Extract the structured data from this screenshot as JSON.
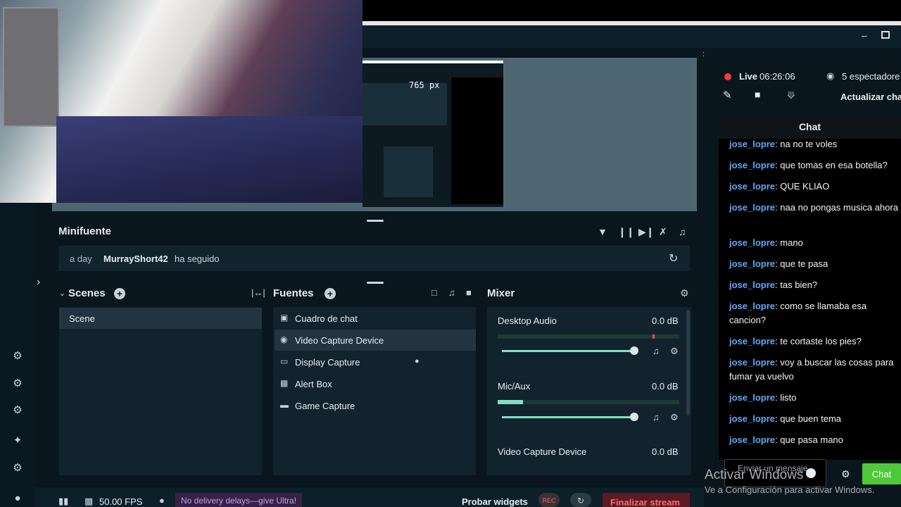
{
  "preview": {
    "nested_px_label": "765 px"
  },
  "minifuente": {
    "title": "Minifuente",
    "alert": {
      "time": "a day",
      "user": "MurrayShort42",
      "action": "ha seguido"
    }
  },
  "scenes": {
    "title": "Scenes",
    "items": [
      "Scene"
    ]
  },
  "fuentes": {
    "title": "Fuentes",
    "items": [
      {
        "label": "Cuadro de chat",
        "icon": "chat-bubble-icon"
      },
      {
        "label": "Video Capture Device",
        "icon": "camera-icon",
        "selected": true
      },
      {
        "label": "Display Capture",
        "icon": "monitor-icon"
      },
      {
        "label": "Alert Box",
        "icon": "alert-box-icon"
      },
      {
        "label": "Game Capture",
        "icon": "gamepad-icon"
      }
    ]
  },
  "mixer": {
    "title": "Mixer",
    "channels": [
      {
        "name": "Desktop Audio",
        "db": "0.0 dB",
        "volume": 0.85
      },
      {
        "name": "Mic/Aux",
        "db": "0.0 dB",
        "volume": 0.85
      },
      {
        "name": "Video Capture Device",
        "db": "0.0 dB"
      }
    ]
  },
  "bottombar": {
    "fps": "50.00 FPS",
    "ultra": "No delivery delays—give Ultra!",
    "probar": "Probar widgets",
    "rec": "REC",
    "finalizar": "Finalizar stream"
  },
  "stream": {
    "live_label": "Live",
    "live_time": "06:26:06",
    "viewers": "5 espectadore",
    "actualizar": "Actualizar cha"
  },
  "chat": {
    "title": "Chat",
    "messages": [
      {
        "user": "jose_lopre",
        "text": "na no te voles"
      },
      {
        "user": "jose_lopre",
        "text": "que tomas en esa botella?"
      },
      {
        "user": "jose_lopre",
        "text": "QUE KLIAO"
      },
      {
        "user": "jose_lopre",
        "text": "naa no pongas musica ahora"
      },
      {
        "user": "jose_lopre",
        "text": "mano"
      },
      {
        "user": "jose_lopre",
        "text": "que te pasa"
      },
      {
        "user": "jose_lopre",
        "text": "tas bien?"
      },
      {
        "user": "jose_lopre",
        "text": "como se llamaba esa cancion?"
      },
      {
        "user": "jose_lopre",
        "text": "te cortaste los pies?"
      },
      {
        "user": "jose_lopre",
        "text": "voy a buscar las cosas para fumar ya vuelvo"
      },
      {
        "user": "jose_lopre",
        "text": "listo"
      },
      {
        "user": "jose_lopre",
        "text": "que buen tema"
      },
      {
        "user": "jose_lopre",
        "text": "que pasa mano"
      }
    ],
    "input_placeholder": "Enviar un mensaje",
    "send_label": "Chat"
  },
  "watermark": {
    "line1": "Activar Windows",
    "line2": "Ve a Configuración para activar Windows."
  },
  "colors": {
    "accent": "#4ec93a",
    "live": "#ff3b3b",
    "username": "#5da9f5",
    "meter": "#7fe0c6"
  }
}
